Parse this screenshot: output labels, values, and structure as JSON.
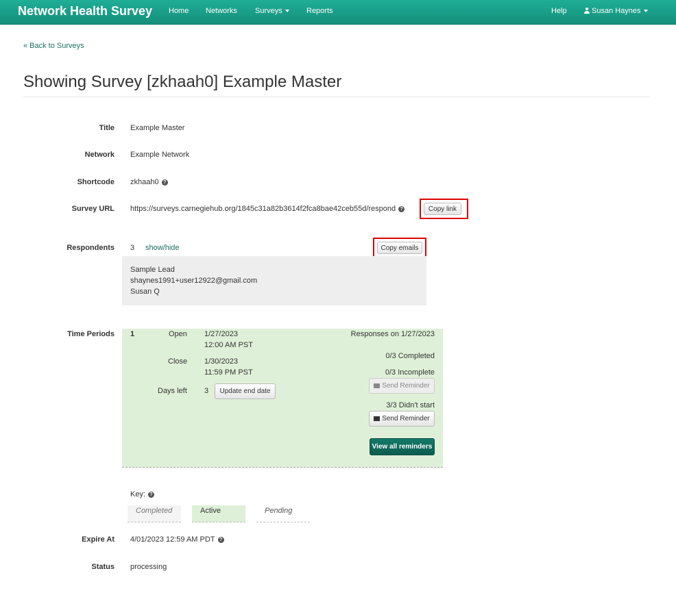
{
  "nav": {
    "brand": "Network Health Survey",
    "home": "Home",
    "networks": "Networks",
    "surveys": "Surveys",
    "reports": "Reports",
    "help": "Help",
    "user": "Susan Haynes"
  },
  "back_link": "« Back to Surveys",
  "page_title": "Showing Survey [zkhaah0] Example Master",
  "fields": {
    "title_label": "Title",
    "title_value": "Example Master",
    "network_label": "Network",
    "network_value": "Example Network",
    "shortcode_label": "Shortcode",
    "shortcode_value": "zkhaah0",
    "url_label": "Survey URL",
    "url_value": "https://surveys.carnegiehub.org/1845c31a82b3614f2fca8bae42ceb55d/respond",
    "copy_link": "Copy link",
    "respondents_label": "Respondents",
    "respondents_count": "3",
    "show_hide": "show/hide",
    "copy_emails": "Copy emails",
    "respondents": [
      "Sample Lead",
      "shaynes1991+user12922@gmail.com",
      "Susan Q"
    ],
    "time_periods_label": "Time Periods",
    "expire_label": "Expire At",
    "expire_value": "4/01/2023 12:59 AM PDT",
    "status_label": "Status",
    "status_value": "processing"
  },
  "period": {
    "number": "1",
    "open_label": "Open",
    "open_date": "1/27/2023",
    "open_time": "12:00 AM PST",
    "close_label": "Close",
    "close_date": "1/30/2023",
    "close_time": "11:59 PM PST",
    "days_left_label": "Days left",
    "days_left": "3",
    "update_end": "Update end date",
    "responses_on": "Responses on 1/27/2023",
    "completed": "0/3 Completed",
    "incomplete": "0/3 Incomplete",
    "send_reminder": "Send Reminder",
    "didnt_start": "3/3 Didn't start",
    "view_all": "View all reminders"
  },
  "key": {
    "label": "Key:",
    "completed": "Completed",
    "active": "Active",
    "pending": "Pending"
  },
  "colors": {
    "nav": "#1aa58e",
    "active_bg": "#dff0d8",
    "highlight": "#e00000"
  }
}
